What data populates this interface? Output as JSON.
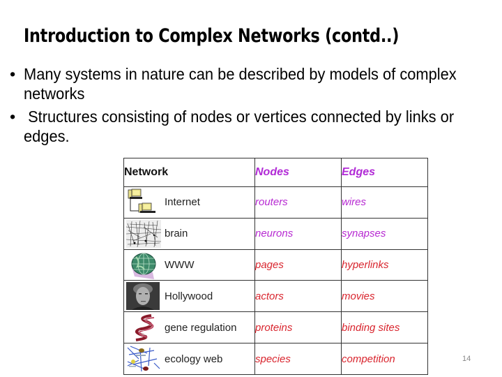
{
  "slide": {
    "title": "Introduction to Complex Networks (contd..)",
    "bullets": [
      "Many systems in nature can be described by models of complex networks",
      " Structures consisting of nodes or vertices connected by links or edges."
    ],
    "bullet_glyph": "•",
    "page_number": "14"
  },
  "table": {
    "headers": [
      "Network",
      "Nodes",
      "Edges"
    ],
    "rows": [
      {
        "icon": "computers-icon",
        "network": "Internet",
        "nodes": "routers",
        "edges": "wires",
        "color": "#b72ad2"
      },
      {
        "icon": "neurons-icon",
        "network": "brain",
        "nodes": "neurons",
        "edges": "synapses",
        "color": "#b72ad2"
      },
      {
        "icon": "globe-icon",
        "network": "WWW",
        "nodes": "pages",
        "edges": "hyperlinks",
        "color": "#d9252e"
      },
      {
        "icon": "actor-portrait-icon",
        "network": "Hollywood",
        "nodes": "actors",
        "edges": "movies",
        "color": "#d9252e"
      },
      {
        "icon": "dna-helix-icon",
        "network": "gene regulation",
        "nodes": "proteins",
        "edges": "binding sites",
        "color": "#d9252e"
      },
      {
        "icon": "food-web-icon",
        "network": "ecology web",
        "nodes": "species",
        "edges": "competition",
        "color": "#d9252e"
      }
    ]
  }
}
